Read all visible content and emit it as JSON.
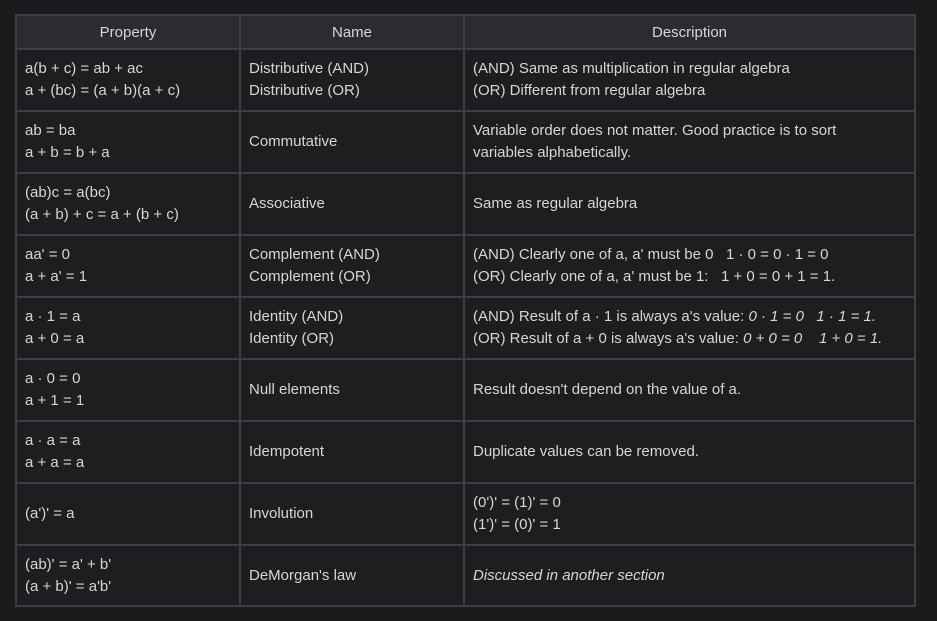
{
  "headers": {
    "property": "Property",
    "name": "Name",
    "description": "Description"
  },
  "rows": [
    {
      "property": [
        "a(b + c) = ab + ac",
        "a + (bc) = (a + b)(a + c)"
      ],
      "name": [
        "Distributive (AND)",
        "Distributive (OR)"
      ],
      "description": [
        "(AND) Same as multiplication in regular algebra",
        "(OR) Different from regular algebra"
      ]
    },
    {
      "property": [
        "ab = ba",
        "a + b = b + a"
      ],
      "name": [
        "Commutative"
      ],
      "description": [
        "Variable order does not matter. Good practice is to sort",
        "variables alphabetically."
      ]
    },
    {
      "property": [
        "(ab)c = a(bc)",
        "(a + b) + c = a + (b + c)"
      ],
      "name": [
        "Associative"
      ],
      "description": [
        "Same as regular algebra"
      ]
    },
    {
      "property": [
        "aa' = 0",
        "a + a' = 1"
      ],
      "name": [
        "Complement (AND)",
        "Complement (OR)"
      ],
      "description": [
        "(AND) Clearly one of a, a' must be 0   1 · 0 = 0 · 1 = 0",
        "(OR) Clearly one of a, a' must be 1:   1 + 0 = 0 + 1 = 1."
      ]
    },
    {
      "property": [
        "a · 1 = a",
        "a + 0 = a"
      ],
      "name": [
        "Identity (AND)",
        "Identity (OR)"
      ],
      "description": [
        "(AND) Result of a · 1 is always a's value:",
        "(OR) Result of a + 0 is always a's value:"
      ],
      "description_italic": [
        "0 · 1 = 0   1 · 1 = 1.",
        "0 + 0 = 0    1 + 0 = 1."
      ]
    },
    {
      "property": [
        "a · 0 = 0",
        "a + 1 = 1"
      ],
      "name": [
        "Null elements"
      ],
      "description": [
        "Result doesn't depend on the value of a."
      ]
    },
    {
      "property": [
        "a · a = a",
        "a + a = a"
      ],
      "name": [
        "Idempotent"
      ],
      "description": [
        "Duplicate values can be removed."
      ]
    },
    {
      "property": [
        "(a')' = a"
      ],
      "name": [
        "Involution"
      ],
      "description": [
        "(0')' = (1)' = 0",
        "(1')' = (0)' = 1"
      ]
    },
    {
      "property": [
        "(ab)' = a' + b'",
        "(a + b)' = a'b'"
      ],
      "name": [
        "DeMorgan's law"
      ],
      "description": [],
      "description_italic_only": "Discussed in another section"
    }
  ]
}
